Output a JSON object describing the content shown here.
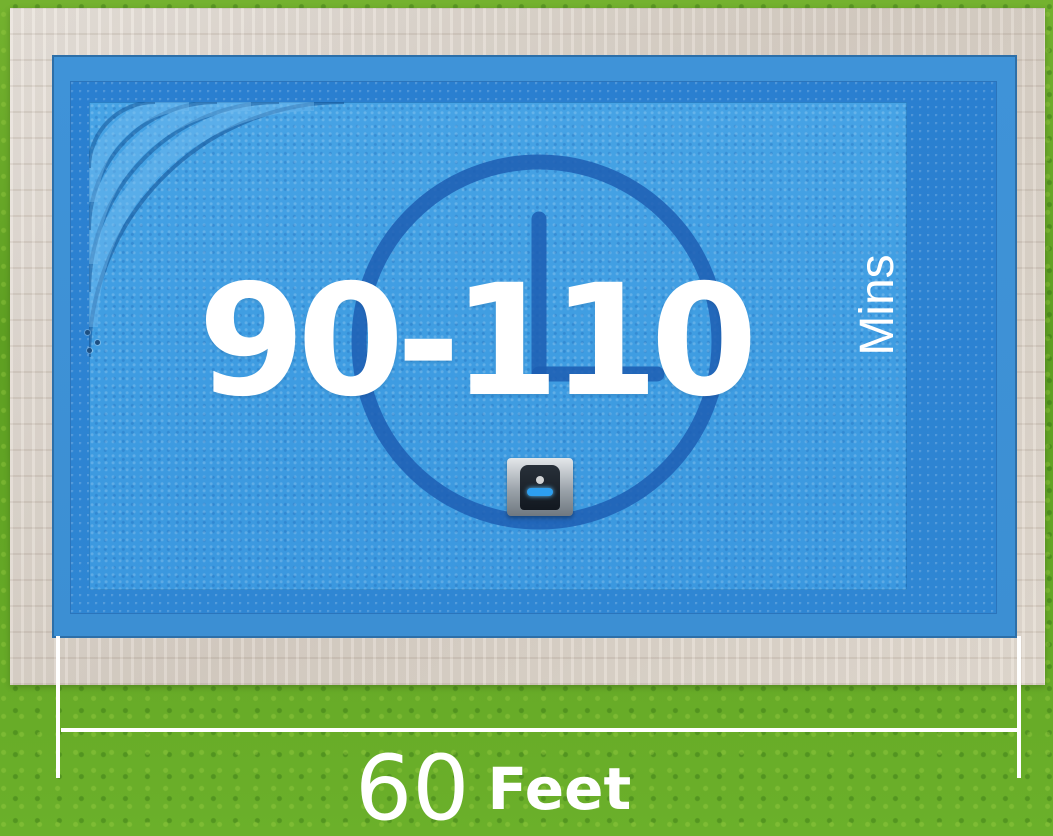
{
  "graphic": {
    "time_range": "90-110",
    "time_unit": "Mins",
    "pool_width_value": "60",
    "pool_width_unit": "Feet"
  },
  "colors": {
    "pool_blue": "#3f9de2",
    "clock_blue": "#1d5eb3",
    "grass_green": "#5e9f22",
    "deck_beige": "#e5ddd3",
    "text_white": "#ffffff",
    "robot_accent": "#2d9ff0"
  },
  "icons": {
    "clock": "clock-icon",
    "robot": "pool-robot-icon"
  }
}
